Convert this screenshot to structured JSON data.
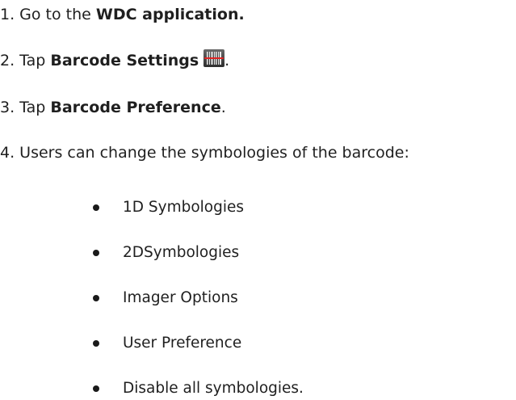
{
  "steps": [
    {
      "prefix": "1. Go to the ",
      "bold": "WDC application.",
      "suffix": ""
    },
    {
      "prefix": "2. Tap ",
      "bold": "Barcode Settings",
      "suffix": ".",
      "icon": "barcode-scanner-icon"
    },
    {
      "prefix": "3. Tap ",
      "bold": "Barcode Preference",
      "suffix": "."
    },
    {
      "text": "4. Users can change the symbologies of the barcode:"
    }
  ],
  "symbologies": [
    "1D Symbologies",
    "2DSymbologies",
    "Imager Options",
    "User Preference",
    "Disable all symbologies."
  ]
}
